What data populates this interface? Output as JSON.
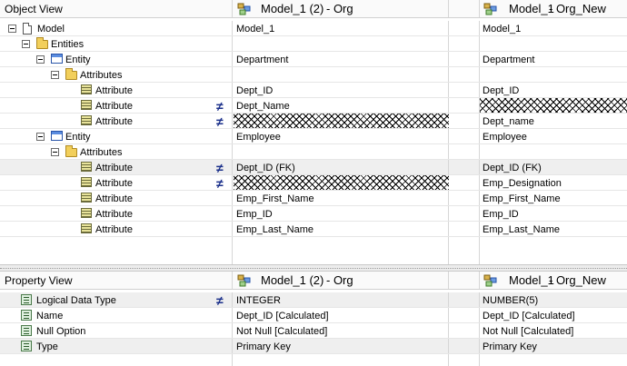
{
  "object_view": {
    "header": {
      "title": "Object View",
      "left_model": "Model_1 (2)",
      "left_suffix": " - Org",
      "right_model": "Model_1",
      "right_suffix": " - Org_New"
    },
    "rows": [
      {
        "label": "Model",
        "left": "Model_1",
        "right": "Model_1"
      },
      {
        "label": "Entities",
        "left": "",
        "right": ""
      },
      {
        "label": "Entity",
        "left": "Department",
        "right": "Department"
      },
      {
        "label": "Attributes",
        "left": "",
        "right": ""
      },
      {
        "label": "Attribute",
        "left": "Dept_ID",
        "right": "Dept_ID"
      },
      {
        "label": "Attribute",
        "left": "Dept_Name",
        "right": ""
      },
      {
        "label": "Attribute",
        "left": "",
        "right": "Dept_name"
      },
      {
        "label": "Entity",
        "left": "Employee",
        "right": "Employee"
      },
      {
        "label": "Attributes",
        "left": "",
        "right": ""
      },
      {
        "label": "Attribute",
        "left": "Dept_ID (FK)",
        "right": "Dept_ID (FK)"
      },
      {
        "label": "Attribute",
        "left": "",
        "right": "Emp_Designation"
      },
      {
        "label": "Attribute",
        "left": "Emp_First_Name",
        "right": "Emp_First_Name"
      },
      {
        "label": "Attribute",
        "left": "Emp_ID",
        "right": "Emp_ID"
      },
      {
        "label": "Attribute",
        "left": "Emp_Last_Name",
        "right": "Emp_Last_Name"
      }
    ]
  },
  "property_view": {
    "header": {
      "title": "Property View",
      "left_model": "Model_1 (2)",
      "left_suffix": " - Org",
      "right_model": "Model_1",
      "right_suffix": " - Org_New"
    },
    "rows": [
      {
        "label": "Logical Data Type",
        "left": "INTEGER",
        "right": "NUMBER(5)"
      },
      {
        "label": "Name",
        "left": "Dept_ID [Calculated]",
        "right": "Dept_ID [Calculated]"
      },
      {
        "label": "Null Option",
        "left": "Not Null [Calculated]",
        "right": "Not Null [Calculated]"
      },
      {
        "label": "Type",
        "left": "Primary Key",
        "right": "Primary Key"
      }
    ]
  },
  "icons": {
    "not_equal": "≠",
    "diff_color": "#1a2f8a",
    "arrow_color": "#4d7fc9"
  }
}
